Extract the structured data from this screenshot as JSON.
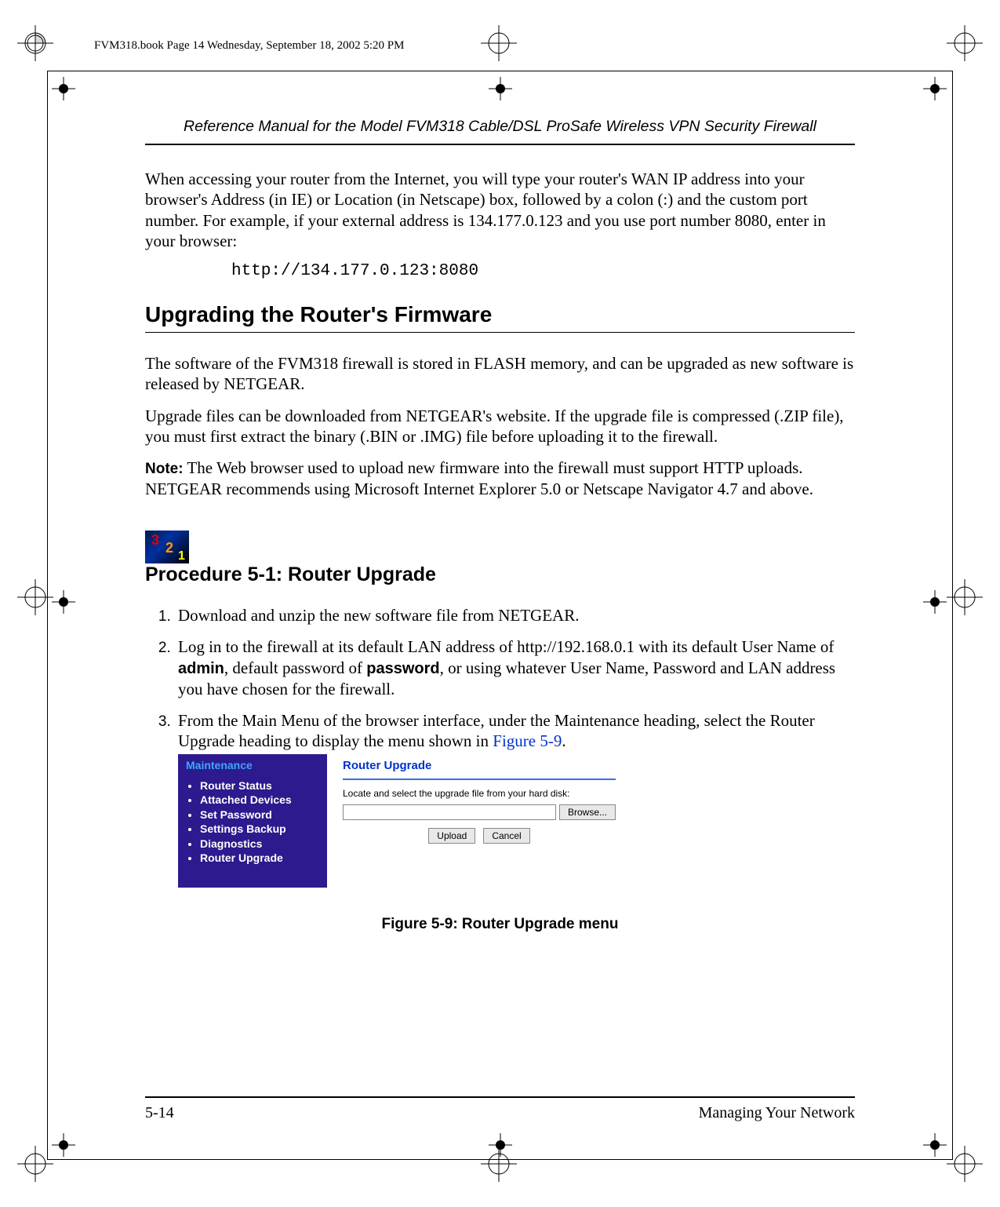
{
  "meta": {
    "header_line": "FVM318.book  Page 14  Wednesday, September 18, 2002  5:20 PM"
  },
  "running_title": "Reference Manual for the Model FVM318 Cable/DSL ProSafe Wireless VPN Security Firewall",
  "intro_para": "When accessing your router from the Internet, you will type your router's WAN IP address into your browser's Address (in IE) or Location (in Netscape) box, followed by a colon (:) and the custom port number. For example, if your external address is 134.177.0.123 and you use port number 8080, enter in your browser:",
  "code_line": "http://134.177.0.123:8080",
  "section_title": "Upgrading the Router's Firmware",
  "upgrade_p1": "The software of the FVM318 firewall is stored in FLASH memory, and can be upgraded as new software is released by NETGEAR.",
  "upgrade_p2": "Upgrade files can be downloaded from NETGEAR's website. If the upgrade file is compressed (.ZIP file), you must first extract the binary (.BIN or .IMG) file before uploading it to the firewall.",
  "note_label": "Note:",
  "note_text": " The Web browser used to upload new firmware into the firewall must support HTTP uploads. NETGEAR recommends using Microsoft Internet Explorer 5.0 or Netscape Navigator 4.7 and above.",
  "procedure_title": "Procedure 5-1:  Router Upgrade",
  "steps": {
    "s1": "Download and unzip the new software file from NETGEAR.",
    "s2_a": "Log in to the firewall at its default LAN address of http://192.168.0.1 with its default User Name of ",
    "s2_admin": "admin",
    "s2_b": ", default password of ",
    "s2_password": "password",
    "s2_c": ", or using whatever User Name, Password and LAN address you have chosen for the firewall.",
    "s3_a": "From the Main Menu of the browser interface, under the Maintenance heading, select the Router Upgrade heading to display the menu shown in ",
    "s3_ref": "Figure 5-9",
    "s3_b": "."
  },
  "screenshot": {
    "nav_heading": "Maintenance",
    "nav_items": [
      "Router Status",
      "Attached Devices",
      "Set Password",
      "Settings Backup",
      "Diagnostics",
      "Router Upgrade"
    ],
    "panel_title": "Router Upgrade",
    "locate_label": "Locate and select the upgrade file from your hard disk:",
    "browse": "Browse...",
    "upload": "Upload",
    "cancel": "Cancel"
  },
  "figure_caption": "Figure 5-9: Router Upgrade menu",
  "footer": {
    "page": "5-14",
    "section": "Managing Your Network"
  }
}
